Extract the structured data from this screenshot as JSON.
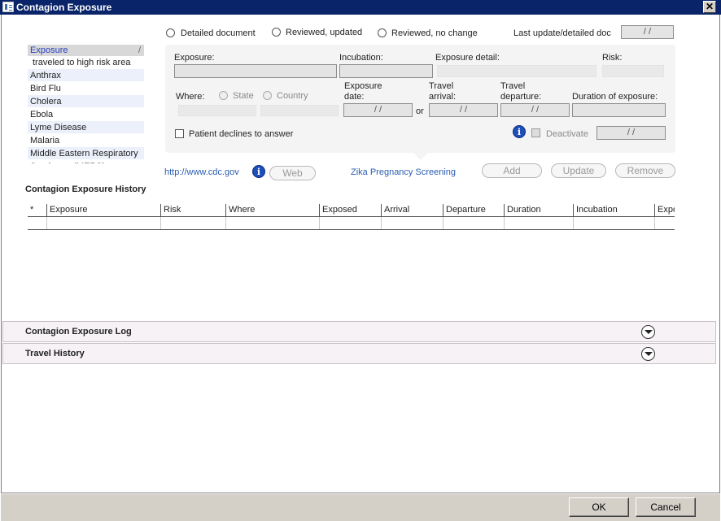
{
  "window": {
    "title": "Contagion Exposure",
    "close_glyph": "✕"
  },
  "exposure_list": {
    "header": "Exposure",
    "header_mark": "/",
    "items": [
      "traveled to high risk area",
      "Anthrax",
      "Bird Flu",
      "Cholera",
      "Ebola",
      "Lyme Disease",
      "Malaria",
      "Middle Eastern Respiratory Syndrome (MERS)"
    ]
  },
  "review_options": {
    "detailed": "Detailed document",
    "reviewed_updated": "Reviewed, updated",
    "reviewed_no_change": "Reviewed, no change",
    "last_update_label": "Last update/detailed doc",
    "last_update_value": "/ /"
  },
  "form": {
    "exposure_label": "Exposure:",
    "incubation_label": "Incubation:",
    "exposure_detail_label": "Exposure detail:",
    "risk_label": "Risk:",
    "where_label": "Where:",
    "state_label": "State",
    "country_label": "Country",
    "exposure_date_label_1": "Exposure",
    "exposure_date_label_2": "date:",
    "exposure_date_value": "/ /",
    "or_label": "or",
    "travel_arrival_label_1": "Travel",
    "travel_arrival_label_2": "arrival:",
    "travel_arrival_value": "/ /",
    "travel_departure_label_1": "Travel",
    "travel_departure_label_2": "departure:",
    "travel_departure_value": "/ /",
    "duration_label": "Duration of exposure:",
    "declines_label": "Patient declines to answer",
    "deactivate_label": "Deactivate",
    "deactivate_date_value": "/ /",
    "info_glyph": "i"
  },
  "actions": {
    "cdc_link": "http://www.cdc.gov",
    "web_button": "Web",
    "zika_link": "Zika Pregnancy Screening",
    "add_button": "Add",
    "update_button": "Update",
    "remove_button": "Remove"
  },
  "history": {
    "title": "Contagion Exposure History",
    "columns": [
      "*",
      "Exposure",
      "Risk",
      "Where",
      "Exposed",
      "Arrival",
      "Departure",
      "Duration",
      "Incubation",
      "Expo"
    ]
  },
  "sections": {
    "log_title": "Contagion Exposure Log",
    "travel_title": "Travel History"
  },
  "footer": {
    "ok_button": "OK",
    "cancel_button": "Cancel"
  }
}
